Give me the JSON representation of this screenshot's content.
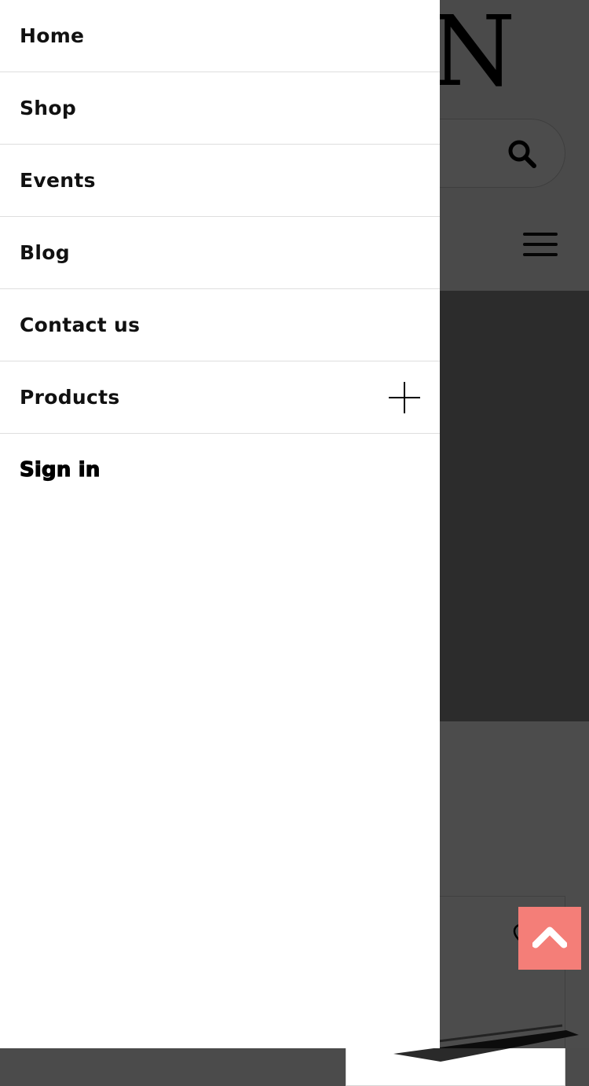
{
  "drawer": {
    "items": [
      {
        "label": "Home"
      },
      {
        "label": "Shop"
      },
      {
        "label": "Events"
      },
      {
        "label": "Blog"
      },
      {
        "label": "Contact us"
      },
      {
        "label": "Products",
        "expandable": true
      }
    ],
    "signin_label": "Sign in"
  },
  "header": {
    "logo_glyph": "N"
  },
  "icons": {
    "search": "search-icon",
    "menu": "hamburger-menu-icon",
    "expand": "plus-icon",
    "back_to_top": "chevron-up-icon",
    "wishlist": "heart-icon"
  },
  "colors": {
    "overlay": "#000000",
    "back_to_top_bg": "#f47e78",
    "text": "#111111",
    "divider": "#dedede"
  }
}
